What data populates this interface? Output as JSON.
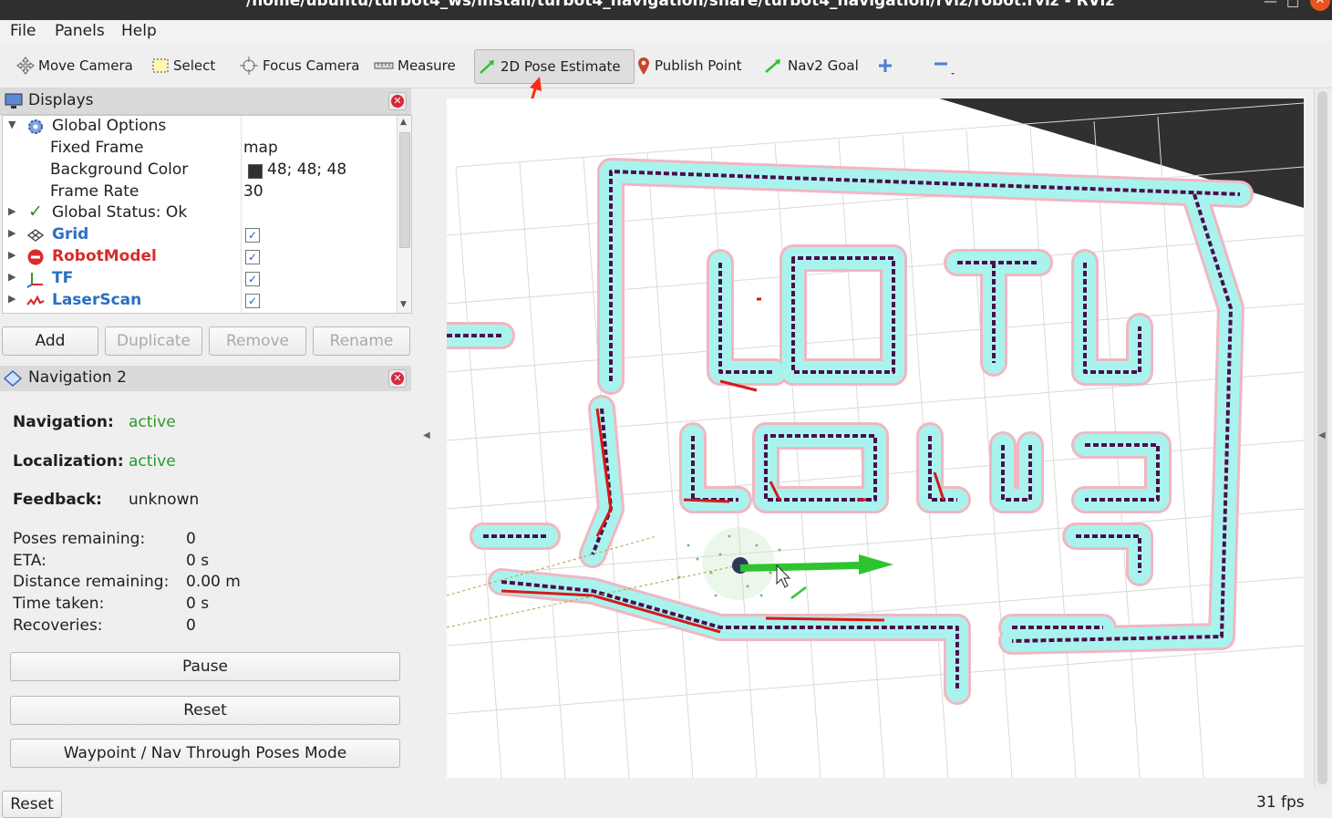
{
  "window": {
    "title": "/home/ubuntu/turbot4_ws/install/turbot4_navigation/share/turbot4_navigation/rviz/robot.rviz - RViz"
  },
  "menubar": {
    "file": "File",
    "panels": "Panels",
    "help": "Help"
  },
  "toolbar": {
    "move_camera": "Move Camera",
    "select": "Select",
    "focus_camera": "Focus Camera",
    "measure": "Measure",
    "pose_estimate": "2D Pose Estimate",
    "publish_point": "Publish Point",
    "nav2_goal": "Nav2 Goal"
  },
  "displays": {
    "title": "Displays",
    "global_options": "Global Options",
    "fixed_frame_label": "Fixed Frame",
    "fixed_frame_value": "map",
    "bg_color_label": "Background Color",
    "bg_color_value": "48; 48; 48",
    "frame_rate_label": "Frame Rate",
    "frame_rate_value": "30",
    "global_status": "Global Status: Ok",
    "items": [
      {
        "name": "Grid",
        "color": "#2b6fc2",
        "checked": "✓"
      },
      {
        "name": "RobotModel",
        "color": "#d62c2c",
        "checked": "✓"
      },
      {
        "name": "TF",
        "color": "#2b6fc2",
        "checked": "✓"
      },
      {
        "name": "LaserScan",
        "color": "#2b6fc2",
        "checked": "✓"
      }
    ],
    "add": "Add",
    "duplicate": "Duplicate",
    "remove": "Remove",
    "rename": "Rename"
  },
  "navigation": {
    "title": "Navigation 2",
    "nav_label": "Navigation:",
    "nav_value": "active",
    "loc_label": "Localization:",
    "loc_value": "active",
    "feedback_label": "Feedback:",
    "feedback_value": "unknown",
    "poses_label": "Poses remaining:",
    "poses_value": "0",
    "eta_label": "ETA:",
    "eta_value": "0 s",
    "dist_label": "Distance remaining:",
    "dist_value": "0.00 m",
    "time_label": "Time taken:",
    "time_value": "0 s",
    "recov_label": "Recoveries:",
    "recov_value": "0",
    "pause": "Pause",
    "reset": "Reset",
    "waypoint": "Waypoint / Nav Through Poses Mode"
  },
  "status": {
    "reset": "Reset",
    "fps": "31 fps"
  },
  "colors": {
    "costmap": "#a9f3ef",
    "obstacle": "#4a0f4a",
    "laser": "#d81818",
    "arrow": "#2fc42f",
    "annotation": "#ff2a10"
  }
}
